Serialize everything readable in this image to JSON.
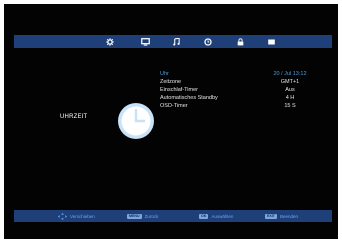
{
  "tabs": [
    {
      "icon": "gear-icon"
    },
    {
      "icon": "tv-monitor-icon"
    },
    {
      "icon": "music-note-icon"
    },
    {
      "icon": "clock-icon"
    },
    {
      "icon": "lock-icon"
    },
    {
      "icon": "rectangle-icon"
    }
  ],
  "page": {
    "section_label": "UHRZEIT"
  },
  "settings": {
    "rows": [
      {
        "label": "Uhr",
        "value": "20 / Jul 13:12"
      },
      {
        "label": "Zeitzone",
        "value": "GMT+1"
      },
      {
        "label": "Einschlaf-Timer",
        "value": "Aus"
      },
      {
        "label": "Automatisches Standby",
        "value": "4 H"
      },
      {
        "label": "OSD-Timer",
        "value": "15 S"
      }
    ]
  },
  "bottom": {
    "move": {
      "label": "Verschieben"
    },
    "back": {
      "key": "MENU",
      "label": "Zurück"
    },
    "ok": {
      "key": "OK",
      "label": "Auswählen"
    },
    "exit": {
      "key": "EXIT",
      "label": "Beenden"
    }
  },
  "colors": {
    "bar": "#1f3f78",
    "highlight": "#4a9fe0",
    "background": "#030303"
  }
}
